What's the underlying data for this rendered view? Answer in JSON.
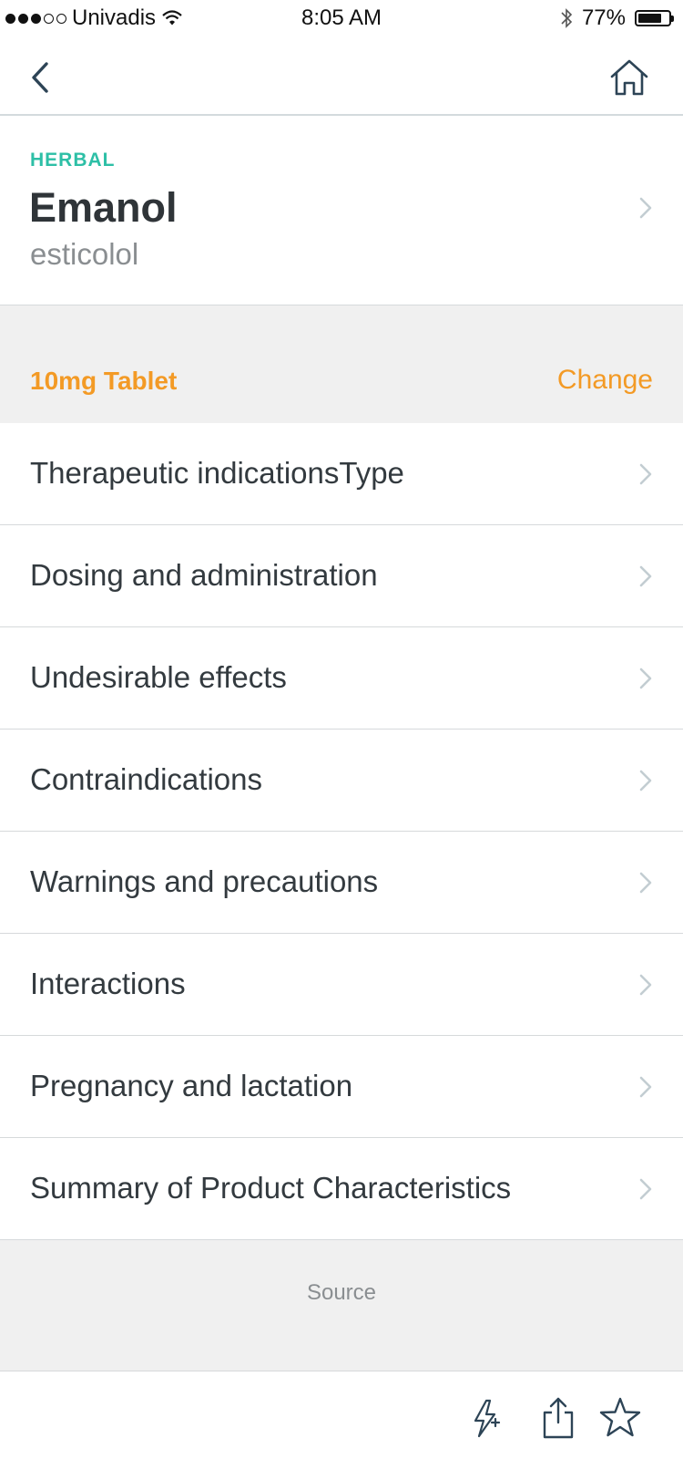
{
  "status_bar": {
    "carrier": "Univadis",
    "time": "8:05 AM",
    "battery_percent": "77%",
    "battery_level": 0.77,
    "signal_bars_filled": 3,
    "signal_bars_total": 5
  },
  "nav": {
    "back_icon": "chevron-left-icon",
    "home_icon": "home-icon"
  },
  "drug": {
    "category": "HERBAL",
    "name": "Emanol",
    "generic": "esticolol"
  },
  "dosage": {
    "form": "10mg Tablet",
    "change_label": "Change"
  },
  "sections": [
    {
      "label": "Therapeutic indicationsType"
    },
    {
      "label": "Dosing and administration"
    },
    {
      "label": "Undesirable effects"
    },
    {
      "label": "Contraindications"
    },
    {
      "label": "Warnings and precautions"
    },
    {
      "label": "Interactions"
    },
    {
      "label": "Pregnancy and lactation"
    },
    {
      "label": "Summary of Product Characteristics"
    }
  ],
  "source": {
    "label": "Source"
  },
  "toolbar": {
    "icons": [
      "quick-action-icon",
      "share-icon",
      "star-icon"
    ]
  },
  "colors": {
    "accent_teal": "#2dbfa6",
    "accent_orange": "#f39a25",
    "text_dark": "#333a3f",
    "text_muted": "#8a8e91",
    "icon_navy": "#2d4456",
    "chevron": "#c3cdd2"
  }
}
